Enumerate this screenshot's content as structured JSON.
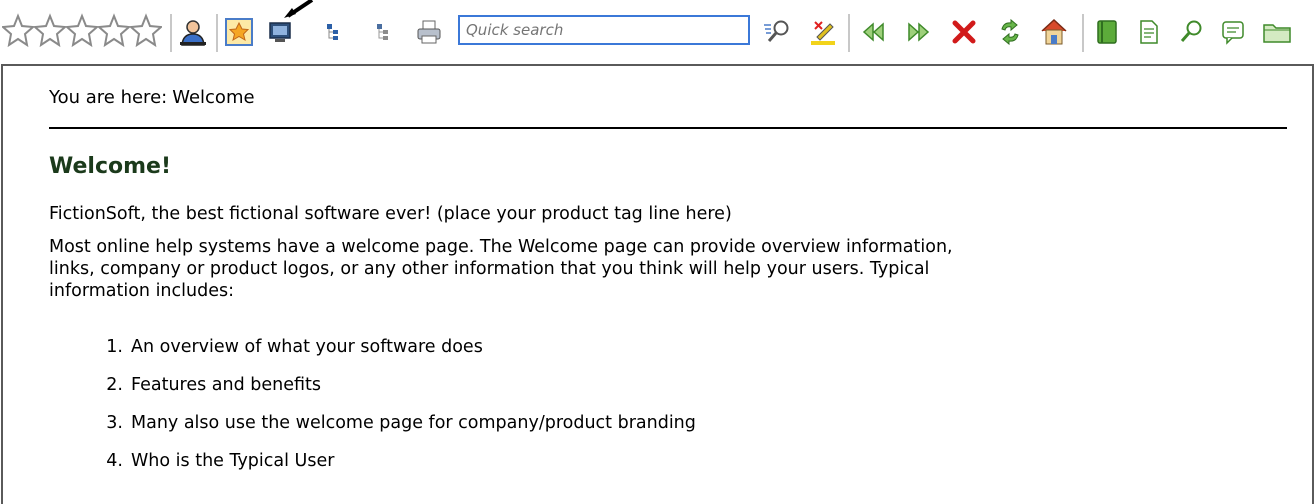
{
  "toolbar": {
    "rating_stars": 5,
    "search_placeholder": "Quick search",
    "colors": {
      "search_border": "#3b78d8",
      "nav_green": "#3f8a2a",
      "delete_red": "#d11a1a"
    },
    "icons": [
      "user-icon",
      "favorites-icon",
      "monitor-icon",
      "toc-tree-icon",
      "toc-tree-alt-icon",
      "print-icon",
      "search-go-icon",
      "highlight-icon",
      "back-icon",
      "forward-icon",
      "stop-icon",
      "refresh-icon",
      "home-icon",
      "book-icon",
      "document-icon",
      "find-icon",
      "comment-icon",
      "folder-icon"
    ]
  },
  "content": {
    "breadcrumb_prefix": "You are here:",
    "breadcrumb_current": "Welcome",
    "heading": "Welcome!",
    "tagline": "FictionSoft, the best fictional software ever! (place your product tag line here)",
    "intro_line1": "Most online help systems have a welcome page. The Welcome page can provide overview information,",
    "intro_line2": "links, company or product logos, or any other information that you think will help your users. Typical",
    "intro_line3": "information includes:",
    "list": [
      {
        "num": "1.",
        "text": "An overview of what your software does"
      },
      {
        "num": "2.",
        "text": "Features and benefits"
      },
      {
        "num": "3.",
        "text": "Many also use the welcome page for company/product branding"
      },
      {
        "num": "4.",
        "text": "Who is the Typical User"
      }
    ],
    "colors": {
      "heading": "#1b3a1b",
      "frame_border": "#5a5a5a"
    }
  }
}
